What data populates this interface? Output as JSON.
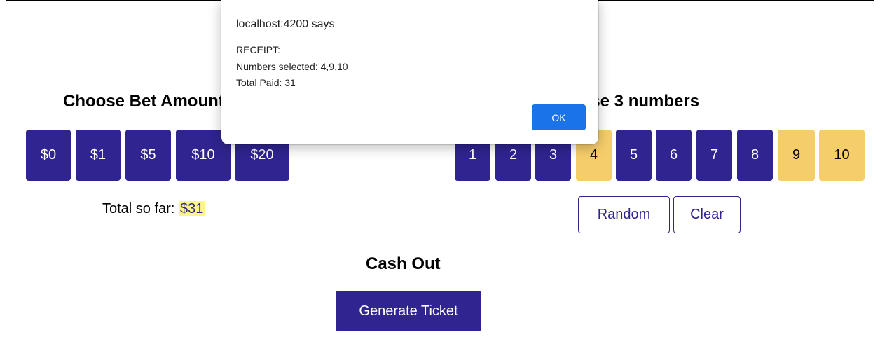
{
  "bet": {
    "heading": "Choose Bet Amount",
    "amounts": [
      "$0",
      "$1",
      "$5",
      "$10",
      "$20"
    ],
    "total_label": "Total so far:",
    "total_value": "$31"
  },
  "numbers": {
    "heading": "Choose 3 numbers",
    "items": [
      "1",
      "2",
      "3",
      "4",
      "5",
      "6",
      "7",
      "8",
      "9",
      "10"
    ],
    "selected": [
      "4",
      "9",
      "10"
    ],
    "random_label": "Random",
    "clear_label": "Clear"
  },
  "cashout": {
    "heading": "Cash Out",
    "generate_label": "Generate Ticket"
  },
  "dialog": {
    "title": "localhost:4200 says",
    "lines": [
      "RECEIPT:",
      "Numbers selected: 4,9,10",
      "Total Paid: 31"
    ],
    "ok_label": "OK"
  },
  "colors": {
    "primary": "#2f2490",
    "selected": "#f6cd6b",
    "highlight": "#fbf58a",
    "dialog_button": "#1a73e8"
  }
}
